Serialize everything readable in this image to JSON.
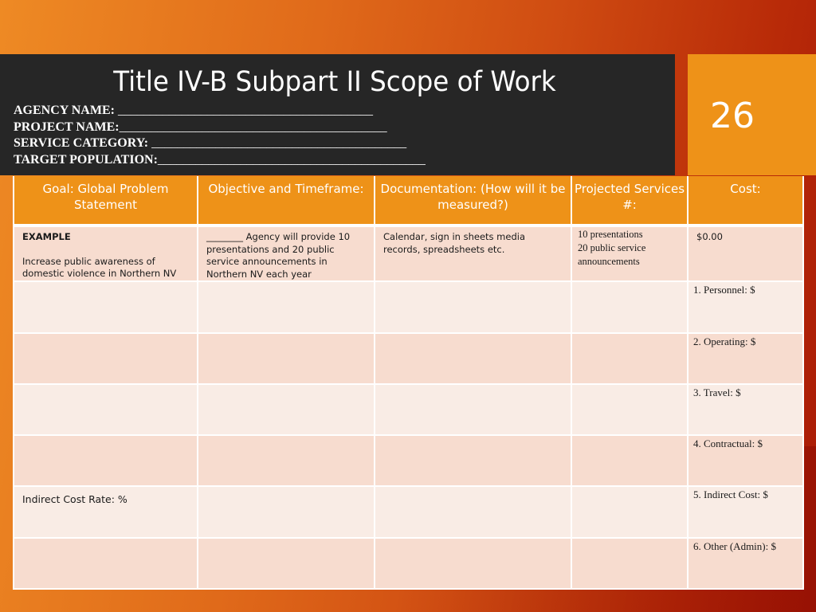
{
  "slide": {
    "title": "Title IV-B Subpart II Scope of Work",
    "slide_number": "26",
    "fields": [
      {
        "label": "AGENCY NAME: ",
        "blank": "________________________________________"
      },
      {
        "label": "PROJECT NAME:",
        "blank": "__________________________________________"
      },
      {
        "label": "SERVICE CATEGORY: ",
        "blank": "________________________________________"
      },
      {
        "label": "TARGET POPULATION:",
        "blank": "__________________________________________"
      }
    ]
  },
  "table": {
    "headers": [
      "Goal: Global Problem Statement",
      "Objective and Timeframe:",
      "Documentation: (How will it be measured?)",
      "Projected Services #:",
      "Cost:"
    ],
    "example_row": {
      "goal_label": "EXAMPLE",
      "goal_text": "Increase public awareness of domestic violence in Northern NV",
      "objective": "________ Agency will provide 10 presentations and 20 public service announcements in Northern NV each year",
      "documentation": "Calendar, sign in sheets media records, spreadsheets etc.",
      "projected_services": [
        "10 presentations",
        "20 public service",
        "announcements"
      ],
      "cost": "$0.00"
    },
    "rows": [
      {
        "goal": "",
        "objective": "",
        "documentation": "",
        "projected": "",
        "cost": "1. Personnel: $"
      },
      {
        "goal": "",
        "objective": "",
        "documentation": "",
        "projected": "",
        "cost": "2. Operating: $"
      },
      {
        "goal": "",
        "objective": "",
        "documentation": "",
        "projected": "",
        "cost": "3. Travel: $"
      },
      {
        "goal": "",
        "objective": "",
        "documentation": "",
        "projected": "",
        "cost": "4. Contractual: $"
      },
      {
        "goal": "Indirect Cost Rate:  %",
        "objective": "",
        "documentation": "",
        "projected": "",
        "cost": "5. Indirect Cost: $"
      },
      {
        "goal": "",
        "objective": "",
        "documentation": "",
        "projected": "",
        "cost": "6. Other (Admin): $"
      }
    ]
  },
  "colors": {
    "header_orange": "#ee9218",
    "banner_dark": "#262626",
    "row_shade_a": "#f7dccf",
    "row_shade_b": "#f9ece5"
  }
}
